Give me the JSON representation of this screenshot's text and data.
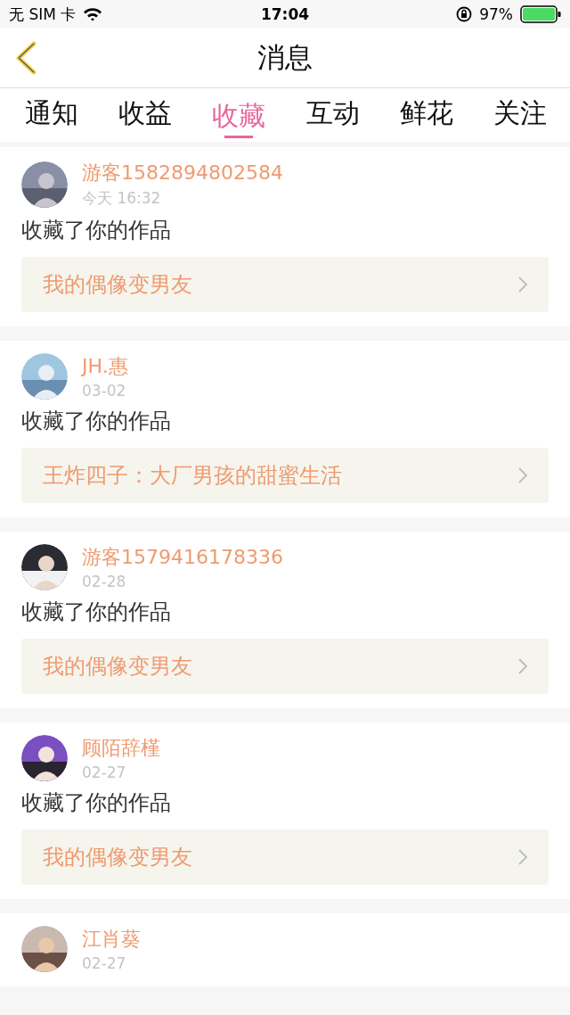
{
  "status_bar": {
    "carrier": "无 SIM 卡",
    "time": "17:04",
    "battery": "97%"
  },
  "nav": {
    "title": "消息"
  },
  "tabs": [
    {
      "label": "通知",
      "selected": false
    },
    {
      "label": "收益",
      "selected": false
    },
    {
      "label": "收藏",
      "selected": true
    },
    {
      "label": "互动",
      "selected": false
    },
    {
      "label": "鲜花",
      "selected": false
    },
    {
      "label": "关注",
      "selected": false
    }
  ],
  "messages": [
    {
      "name": "游客1582894802584",
      "time": "今天 16:32",
      "action": "收藏了你的作品",
      "work": "我的偶像变男友"
    },
    {
      "name": "JH.惠",
      "time": "03-02",
      "action": "收藏了你的作品",
      "work": "王炸四子：大厂男孩的甜蜜生活"
    },
    {
      "name": "游客1579416178336",
      "time": "02-28",
      "action": "收藏了你的作品",
      "work": "我的偶像变男友"
    },
    {
      "name": "顾陌辞槿",
      "time": "02-27",
      "action": "收藏了你的作品",
      "work": "我的偶像变男友"
    },
    {
      "name": "江肖葵",
      "time": "02-27"
    }
  ]
}
